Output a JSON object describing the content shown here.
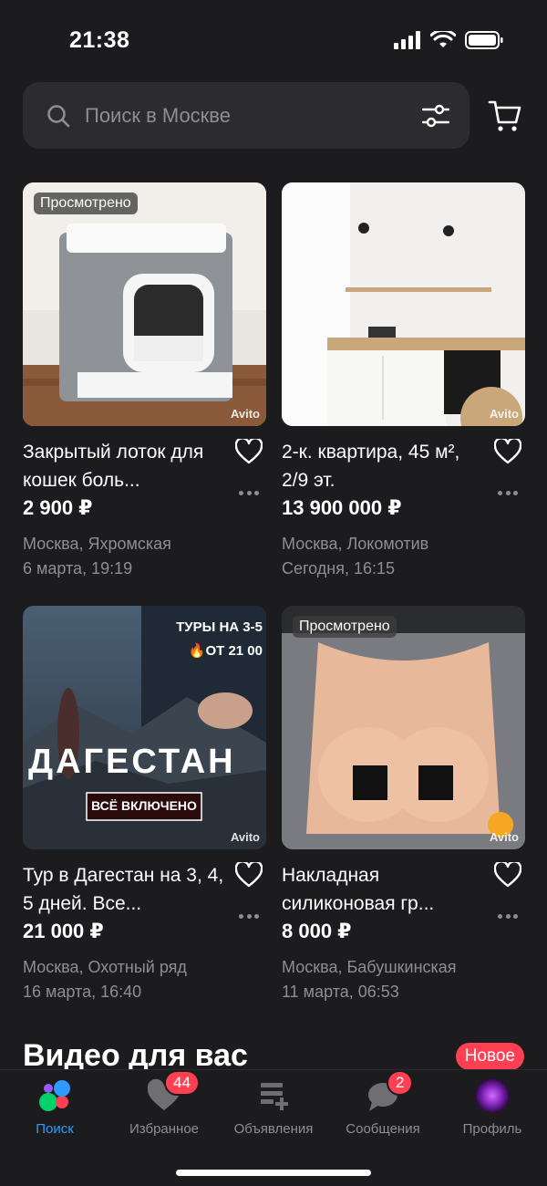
{
  "status": {
    "time": "21:38"
  },
  "search": {
    "placeholder": "Поиск в Москве"
  },
  "listings": [
    {
      "title": "Закрытый лоток для кошек боль...",
      "price": "2 900 ₽",
      "location": "Москва, Яхромская",
      "date": "6 марта, 19:19",
      "badge": "Просмотрено",
      "watermark": "Avito"
    },
    {
      "title": "2-к. квартира, 45 м², 2/9 эт.",
      "price": "13 900 000 ₽",
      "location": "Москва, Локомотив",
      "date": "Сегодня, 16:15",
      "badge": "",
      "watermark": "Avito"
    },
    {
      "title": "Тур в Дагестан на 3, 4, 5 дней. Все...",
      "price": "21 000 ₽",
      "location": "Москва, Охотный ряд",
      "date": "16 марта, 16:40",
      "badge": "",
      "watermark": "Avito",
      "banner": {
        "top": "ТУРЫ НА 3-5",
        "price": "🔥ОТ 21 00",
        "headline": "ДАГЕСТАН",
        "cta": "ВСЁ ВКЛЮЧЕНО"
      }
    },
    {
      "title": "Накладная силиконовая гр...",
      "price": "8 000 ₽",
      "location": "Москва, Бабушкинская",
      "date": "11 марта, 06:53",
      "badge": "Просмотрено",
      "watermark": "Avito"
    }
  ],
  "video_section": {
    "title": "Видео для вас",
    "badge": "Новое"
  },
  "tabs": [
    {
      "label": "Поиск",
      "icon": "avito-logo-icon",
      "active": true
    },
    {
      "label": "Избранное",
      "icon": "heart-icon",
      "badge": "44"
    },
    {
      "label": "Объявления",
      "icon": "add-listing-icon"
    },
    {
      "label": "Сообщения",
      "icon": "chat-bubble-icon",
      "badge": "2"
    },
    {
      "label": "Профиль",
      "icon": "avatar"
    }
  ],
  "colors": {
    "background": "#1c1c1e",
    "accent": "#2d9bff",
    "badge": "#ff4053",
    "secondary_text": "#8e8e93"
  }
}
